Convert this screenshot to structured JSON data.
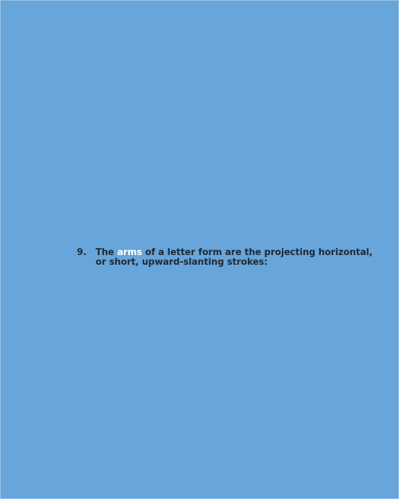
{
  "item": {
    "number": "9.",
    "text_before": "The",
    "highlight": "arms",
    "text_after": "of a letter form are the projecting horizontal, or short, upward-slanting strokes:"
  },
  "colors": {
    "background": "#67a5da",
    "text": "#1f2a36",
    "highlight": "#ffffff"
  }
}
